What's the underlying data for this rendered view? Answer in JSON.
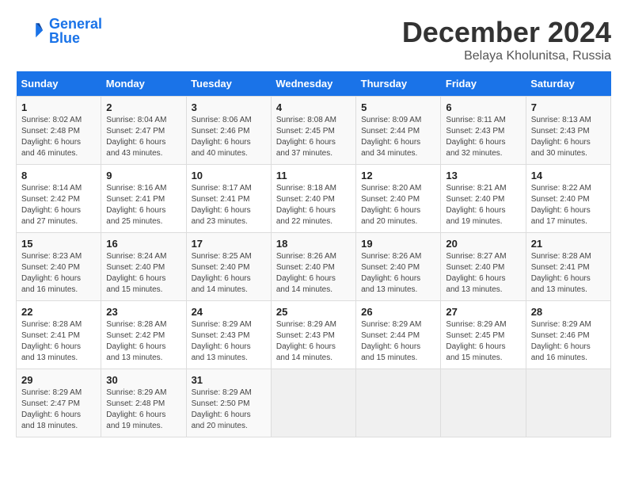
{
  "header": {
    "logo_line1": "General",
    "logo_line2": "Blue",
    "month": "December 2024",
    "location": "Belaya Kholunitsa, Russia"
  },
  "weekdays": [
    "Sunday",
    "Monday",
    "Tuesday",
    "Wednesday",
    "Thursday",
    "Friday",
    "Saturday"
  ],
  "weeks": [
    [
      {
        "day": "1",
        "sunrise": "Sunrise: 8:02 AM",
        "sunset": "Sunset: 2:48 PM",
        "daylight": "Daylight: 6 hours and 46 minutes."
      },
      {
        "day": "2",
        "sunrise": "Sunrise: 8:04 AM",
        "sunset": "Sunset: 2:47 PM",
        "daylight": "Daylight: 6 hours and 43 minutes."
      },
      {
        "day": "3",
        "sunrise": "Sunrise: 8:06 AM",
        "sunset": "Sunset: 2:46 PM",
        "daylight": "Daylight: 6 hours and 40 minutes."
      },
      {
        "day": "4",
        "sunrise": "Sunrise: 8:08 AM",
        "sunset": "Sunset: 2:45 PM",
        "daylight": "Daylight: 6 hours and 37 minutes."
      },
      {
        "day": "5",
        "sunrise": "Sunrise: 8:09 AM",
        "sunset": "Sunset: 2:44 PM",
        "daylight": "Daylight: 6 hours and 34 minutes."
      },
      {
        "day": "6",
        "sunrise": "Sunrise: 8:11 AM",
        "sunset": "Sunset: 2:43 PM",
        "daylight": "Daylight: 6 hours and 32 minutes."
      },
      {
        "day": "7",
        "sunrise": "Sunrise: 8:13 AM",
        "sunset": "Sunset: 2:43 PM",
        "daylight": "Daylight: 6 hours and 30 minutes."
      }
    ],
    [
      {
        "day": "8",
        "sunrise": "Sunrise: 8:14 AM",
        "sunset": "Sunset: 2:42 PM",
        "daylight": "Daylight: 6 hours and 27 minutes."
      },
      {
        "day": "9",
        "sunrise": "Sunrise: 8:16 AM",
        "sunset": "Sunset: 2:41 PM",
        "daylight": "Daylight: 6 hours and 25 minutes."
      },
      {
        "day": "10",
        "sunrise": "Sunrise: 8:17 AM",
        "sunset": "Sunset: 2:41 PM",
        "daylight": "Daylight: 6 hours and 23 minutes."
      },
      {
        "day": "11",
        "sunrise": "Sunrise: 8:18 AM",
        "sunset": "Sunset: 2:40 PM",
        "daylight": "Daylight: 6 hours and 22 minutes."
      },
      {
        "day": "12",
        "sunrise": "Sunrise: 8:20 AM",
        "sunset": "Sunset: 2:40 PM",
        "daylight": "Daylight: 6 hours and 20 minutes."
      },
      {
        "day": "13",
        "sunrise": "Sunrise: 8:21 AM",
        "sunset": "Sunset: 2:40 PM",
        "daylight": "Daylight: 6 hours and 19 minutes."
      },
      {
        "day": "14",
        "sunrise": "Sunrise: 8:22 AM",
        "sunset": "Sunset: 2:40 PM",
        "daylight": "Daylight: 6 hours and 17 minutes."
      }
    ],
    [
      {
        "day": "15",
        "sunrise": "Sunrise: 8:23 AM",
        "sunset": "Sunset: 2:40 PM",
        "daylight": "Daylight: 6 hours and 16 minutes."
      },
      {
        "day": "16",
        "sunrise": "Sunrise: 8:24 AM",
        "sunset": "Sunset: 2:40 PM",
        "daylight": "Daylight: 6 hours and 15 minutes."
      },
      {
        "day": "17",
        "sunrise": "Sunrise: 8:25 AM",
        "sunset": "Sunset: 2:40 PM",
        "daylight": "Daylight: 6 hours and 14 minutes."
      },
      {
        "day": "18",
        "sunrise": "Sunrise: 8:26 AM",
        "sunset": "Sunset: 2:40 PM",
        "daylight": "Daylight: 6 hours and 14 minutes."
      },
      {
        "day": "19",
        "sunrise": "Sunrise: 8:26 AM",
        "sunset": "Sunset: 2:40 PM",
        "daylight": "Daylight: 6 hours and 13 minutes."
      },
      {
        "day": "20",
        "sunrise": "Sunrise: 8:27 AM",
        "sunset": "Sunset: 2:40 PM",
        "daylight": "Daylight: 6 hours and 13 minutes."
      },
      {
        "day": "21",
        "sunrise": "Sunrise: 8:28 AM",
        "sunset": "Sunset: 2:41 PM",
        "daylight": "Daylight: 6 hours and 13 minutes."
      }
    ],
    [
      {
        "day": "22",
        "sunrise": "Sunrise: 8:28 AM",
        "sunset": "Sunset: 2:41 PM",
        "daylight": "Daylight: 6 hours and 13 minutes."
      },
      {
        "day": "23",
        "sunrise": "Sunrise: 8:28 AM",
        "sunset": "Sunset: 2:42 PM",
        "daylight": "Daylight: 6 hours and 13 minutes."
      },
      {
        "day": "24",
        "sunrise": "Sunrise: 8:29 AM",
        "sunset": "Sunset: 2:43 PM",
        "daylight": "Daylight: 6 hours and 13 minutes."
      },
      {
        "day": "25",
        "sunrise": "Sunrise: 8:29 AM",
        "sunset": "Sunset: 2:43 PM",
        "daylight": "Daylight: 6 hours and 14 minutes."
      },
      {
        "day": "26",
        "sunrise": "Sunrise: 8:29 AM",
        "sunset": "Sunset: 2:44 PM",
        "daylight": "Daylight: 6 hours and 15 minutes."
      },
      {
        "day": "27",
        "sunrise": "Sunrise: 8:29 AM",
        "sunset": "Sunset: 2:45 PM",
        "daylight": "Daylight: 6 hours and 15 minutes."
      },
      {
        "day": "28",
        "sunrise": "Sunrise: 8:29 AM",
        "sunset": "Sunset: 2:46 PM",
        "daylight": "Daylight: 6 hours and 16 minutes."
      }
    ],
    [
      {
        "day": "29",
        "sunrise": "Sunrise: 8:29 AM",
        "sunset": "Sunset: 2:47 PM",
        "daylight": "Daylight: 6 hours and 18 minutes."
      },
      {
        "day": "30",
        "sunrise": "Sunrise: 8:29 AM",
        "sunset": "Sunset: 2:48 PM",
        "daylight": "Daylight: 6 hours and 19 minutes."
      },
      {
        "day": "31",
        "sunrise": "Sunrise: 8:29 AM",
        "sunset": "Sunset: 2:50 PM",
        "daylight": "Daylight: 6 hours and 20 minutes."
      },
      null,
      null,
      null,
      null
    ]
  ]
}
